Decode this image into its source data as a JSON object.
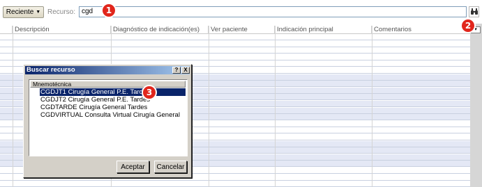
{
  "toolbar": {
    "recent_label": "Reciente",
    "resource_label": "Recurso:",
    "resource_value": "cgd",
    "search_icon": "binoculars-icon"
  },
  "markers": [
    "1",
    "2",
    "3"
  ],
  "grid": {
    "columns": [
      "Descripción",
      "Diagnóstico de indicación(es)",
      "Ver paciente",
      "Indicación principal",
      "Comentarios"
    ]
  },
  "dialog": {
    "title": "Buscar recurso",
    "help_label": "?",
    "close_label": "X",
    "list_header": "Mnemotécnica",
    "items": [
      "CGDJT1 Cirugía General P.E. Tardes",
      "CGDJT2 Cirugía General P.E. Tardes",
      "CGDTARDE Cirugía General Tardes",
      "CGDVIRTUAL Consulta Virtual Cirugía General"
    ],
    "accept_label": "Aceptar",
    "cancel_label": "Cancelar"
  },
  "colors": {
    "marker": "#e1261c",
    "title_bar": "#0a246a",
    "row_shade": "#e4e8f5"
  }
}
